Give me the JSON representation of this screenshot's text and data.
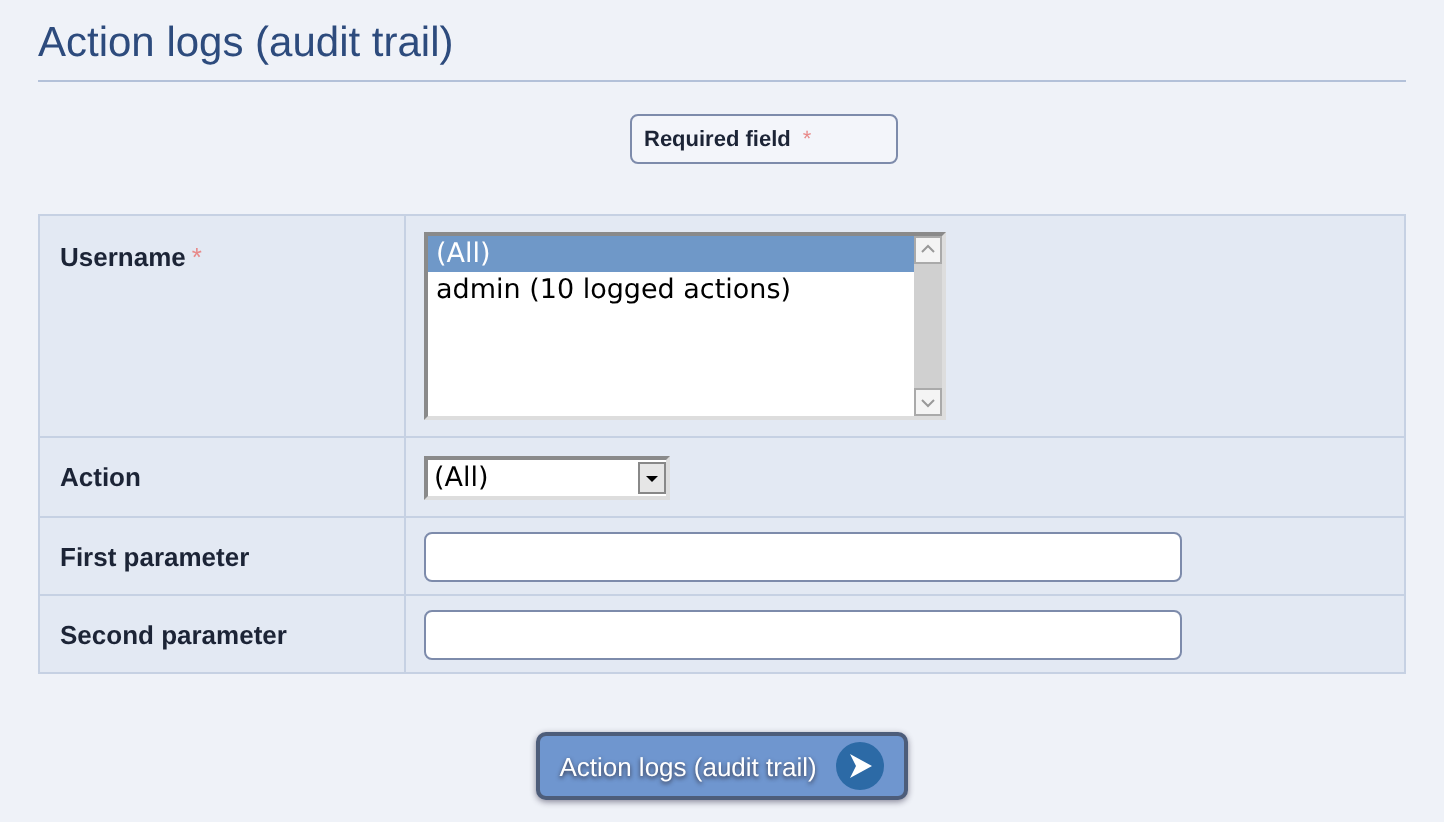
{
  "title": "Action logs (audit trail)",
  "legend": {
    "label": "Required field",
    "mark": "*"
  },
  "rows": [
    {
      "kind": "listbox",
      "label": "Username",
      "required": true,
      "options": [
        {
          "label": "(All)",
          "selected": true
        },
        {
          "label": "admin (10 logged actions)",
          "selected": false
        }
      ]
    },
    {
      "kind": "dropdown",
      "label": "Action",
      "required": false,
      "value": "(All)"
    },
    {
      "kind": "text",
      "label": "First parameter",
      "required": false
    },
    {
      "kind": "text",
      "label": "Second parameter",
      "required": false
    }
  ],
  "submit": {
    "label": "Action logs (audit trail)"
  }
}
